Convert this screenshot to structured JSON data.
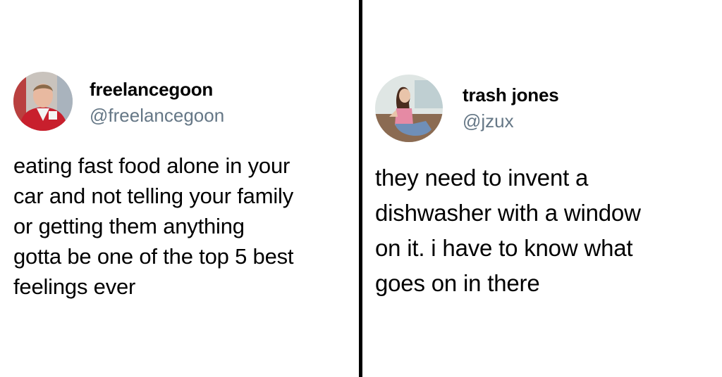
{
  "tweets": [
    {
      "display_name": "freelancegoon",
      "handle": "@freelancegoon",
      "avatar_icon": "profile-photo-man-red-jacket",
      "lines": [
        "eating fast food alone in your",
        "car and not telling your family",
        "or getting them anything",
        "gotta be one of the top 5 best",
        "feelings ever"
      ]
    },
    {
      "display_name": "trash jones",
      "handle": "@jzux",
      "avatar_icon": "profile-photo-woman-pink-top",
      "lines": [
        "they need to invent a",
        "dishwasher with a window",
        "on it. i have to know what",
        "goes on in there"
      ]
    }
  ],
  "colors": {
    "background": "#ffffff",
    "text": "#000000",
    "handle": "#657786",
    "divider": "#000000"
  }
}
